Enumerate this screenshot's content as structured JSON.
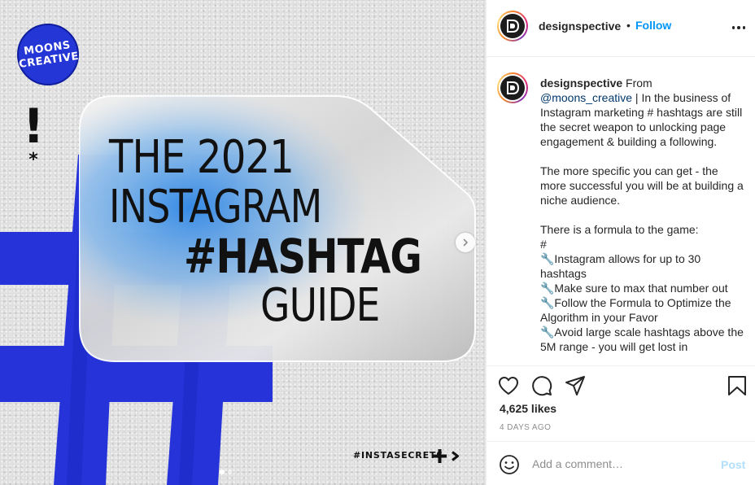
{
  "post": {
    "image": {
      "brand_badge": "MOONS\nCREATIVE",
      "title_lines": [
        "THE 2021",
        "INSTAGRAM",
        "#HASHTAG",
        "GUIDE"
      ],
      "decor_exclaim": "!",
      "decor_asterisk": "*",
      "footer_tag": "#INSTASECRETS",
      "accent_color": "#2b3ce0",
      "carousel": {
        "slides": 2,
        "active_slide": 1
      }
    },
    "author": {
      "username": "designspective",
      "separator": "•",
      "follow_label": "Follow",
      "avatar_icon": "designspective-logo"
    },
    "caption": {
      "username": "designspective",
      "lead": " From ",
      "mention": "@moons_creative",
      "body": " | In the business of Instagram marketing # hashtags are still the secret weapon to unlocking page engagement & building a following.\n\nThe more specific you can get - the more successful you will be at building a niche audience.\n\nThere is a formula to the game:\n#\n🔧Instagram allows for up to 30 hashtags\n🔧Make sure to max that number out\n🔧Follow the Formula to Optimize the Algorithm in your Favor\n🔧Avoid large scale hashtags above the 5M range - you will get lost in"
    },
    "likes": "4,625 likes",
    "time": "4 DAYS AGO",
    "icons": {
      "like": "heart-icon",
      "comment": "comment-icon",
      "share": "share-icon",
      "save": "bookmark-icon",
      "emoji": "emoji-icon",
      "more": "more-options-icon",
      "next": "chevron-right-icon"
    }
  },
  "comment_form": {
    "placeholder": "Add a comment…",
    "post_label": "Post"
  },
  "colors": {
    "link_blue": "#0095f6",
    "post_disabled": "#b2dffc",
    "muted": "#8e8e8e"
  }
}
